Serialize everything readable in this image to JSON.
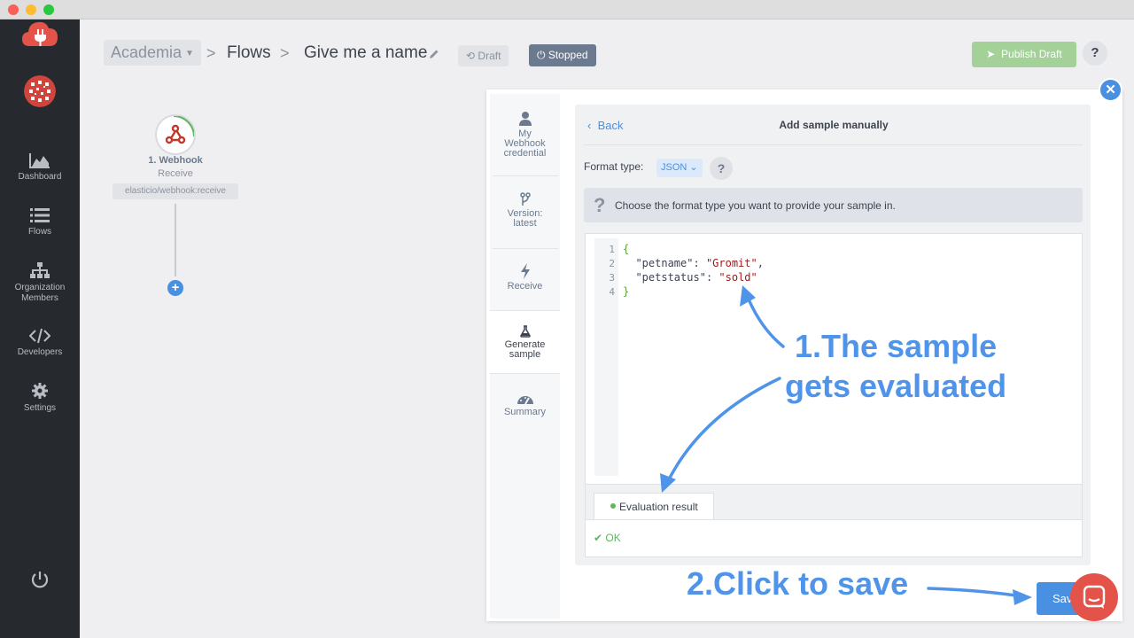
{
  "window": {
    "controls": [
      "close",
      "minimize",
      "zoom"
    ]
  },
  "sidebar": {
    "items": [
      {
        "label": "Dashboard",
        "icon": "dashboard-icon"
      },
      {
        "label": "Flows",
        "icon": "list-icon"
      },
      {
        "label": "Organization Members",
        "icon": "org-chart-icon"
      },
      {
        "label": "Developers",
        "icon": "code-icon"
      },
      {
        "label": "Settings",
        "icon": "gear-icon"
      }
    ],
    "colors": {
      "background": "#262a2f",
      "brand": "#e4534a"
    }
  },
  "header": {
    "workspace": "Academia",
    "breadcrumb_flows": "Flows",
    "flow_name": "Give me a name",
    "draft_label": "Draft",
    "stopped_label": "Stopped",
    "publish_label": "Publish Draft",
    "help_label": "?"
  },
  "flow": {
    "node": {
      "title": "1. Webhook",
      "subtitle": "Receive",
      "component": "elasticio/webhook:receive"
    }
  },
  "panel": {
    "steps": [
      {
        "label": "My Webhook credential",
        "icon": "user-icon"
      },
      {
        "label": "Version: latest",
        "icon": "branch-icon"
      },
      {
        "label": "Receive",
        "icon": "bolt-icon"
      },
      {
        "label": "Generate sample",
        "icon": "flask-icon",
        "active": true
      },
      {
        "label": "Summary",
        "icon": "gauge-icon"
      }
    ],
    "back_label": "Back",
    "title": "Add sample manually",
    "format_label": "Format type:",
    "format_value": "JSON",
    "format_help": "?",
    "info_text": "Choose the format type you want to provide your sample in.",
    "editor": {
      "line_numbers": [
        "1",
        "2",
        "3",
        "4"
      ],
      "lines": [
        {
          "open": "{"
        },
        {
          "key": "\"petname\"",
          "colon": ": ",
          "value": "\"Gromit\"",
          "comma": ","
        },
        {
          "key": "\"petstatus\"",
          "colon": ": ",
          "value": "\"sold\"",
          "comma": ""
        },
        {
          "close": "}"
        }
      ]
    },
    "result_tab": "Evaluation result",
    "result_status": "OK",
    "save_label": "Save"
  },
  "annotations": {
    "note1_line1": "1.The sample",
    "note1_line2": "gets evaluated",
    "note2": "2.Click to save",
    "color": "#4f94e8"
  }
}
